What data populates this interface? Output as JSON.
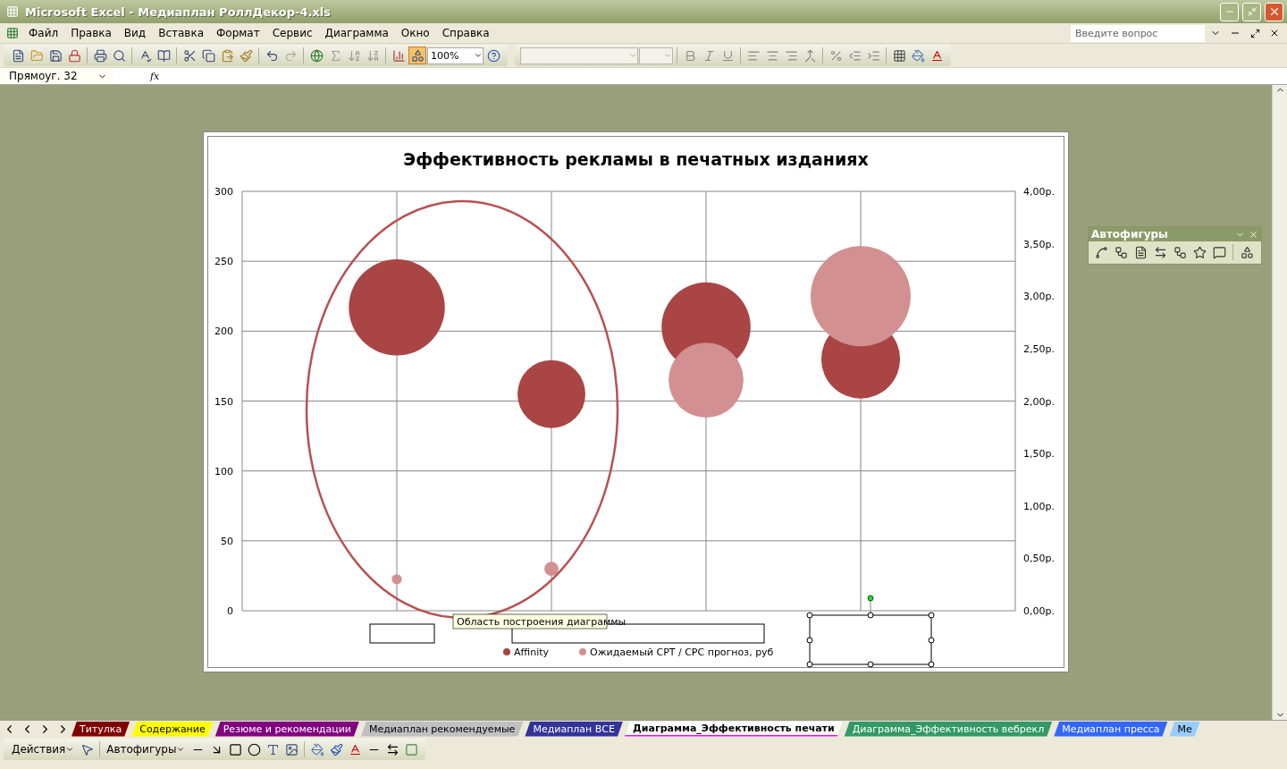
{
  "window": {
    "title": "Microsoft Excel - Медиаплан РоллДекор-4.xls"
  },
  "menu": [
    "Файл",
    "Правка",
    "Вид",
    "Вставка",
    "Формат",
    "Сервис",
    "Диаграмма",
    "Окно",
    "Справка"
  ],
  "help_search": {
    "placeholder": "Введите вопрос"
  },
  "toolbar": {
    "zoom": "100%"
  },
  "formula_bar": {
    "name_box": "Прямоуг. 32",
    "fx": "fx"
  },
  "chart": {
    "title": "Эффективность рекламы в печатных изданиях",
    "chart_data": {
      "type": "scatter",
      "grid": true,
      "legend": "bottom",
      "categories": [
        null,
        null,
        null,
        null
      ],
      "ylim": [
        0,
        300
      ],
      "yticks": [
        0,
        50,
        100,
        150,
        200,
        250,
        300
      ],
      "y2lim": [
        0,
        4
      ],
      "y2ticks": [
        {
          "value": 0,
          "label": "0,00р."
        },
        {
          "value": 0.5,
          "label": "0,50р."
        },
        {
          "value": 1,
          "label": "1,00р."
        },
        {
          "value": 1.5,
          "label": "1,50р."
        },
        {
          "value": 2,
          "label": "2,00р."
        },
        {
          "value": 2.5,
          "label": "2,50р."
        },
        {
          "value": 3,
          "label": "3,00р."
        },
        {
          "value": 3.5,
          "label": "3,50р."
        },
        {
          "value": 4,
          "label": "4,00р."
        }
      ],
      "series": [
        {
          "name": "Affinity",
          "color": "#a94545",
          "values": [
            217,
            155,
            203,
            180
          ],
          "sizes": [
            0.92,
            0.46,
            0.79,
            0.62
          ]
        },
        {
          "name": "Ожидаемый CPT / CPC прогноз, руб",
          "color": "#d29090",
          "axis": "y2",
          "values": [
            0.3,
            0.4,
            2.2,
            3.0
          ],
          "sizes": [
            0.01,
            0.02,
            0.56,
            1
          ]
        }
      ]
    },
    "tooltip": "Область построения диаграммы"
  },
  "autoshapes_toolbar": {
    "title": "Автофигуры"
  },
  "sheet_tabs": [
    {
      "label": "Титулка",
      "color": "#800000",
      "selected": false
    },
    {
      "label": "Содержание",
      "color": "#ffff00",
      "selected": false
    },
    {
      "label": "Резюме и рекомендации",
      "color": "#800080",
      "selected": false
    },
    {
      "label": "Медиаплан рекомендуемые",
      "color": "#c0c0c0",
      "selected": false
    },
    {
      "label": "Медиаплан ВСЕ",
      "color": "#333399",
      "selected": false
    },
    {
      "label": "Диаграмма_Эффективность печати",
      "color": "#ff00ff",
      "selected": true
    },
    {
      "label": "Диаграмма_Эффективность вебрекл",
      "color": "#339966",
      "selected": false
    },
    {
      "label": "Медиаплан пресса",
      "color": "#3366ff",
      "selected": false
    },
    {
      "label": "Ме",
      "color": "#99ccff",
      "selected": false
    }
  ],
  "drawing_toolbar": {
    "actions": "Действия",
    "autoshapes": "Автофигуры"
  }
}
